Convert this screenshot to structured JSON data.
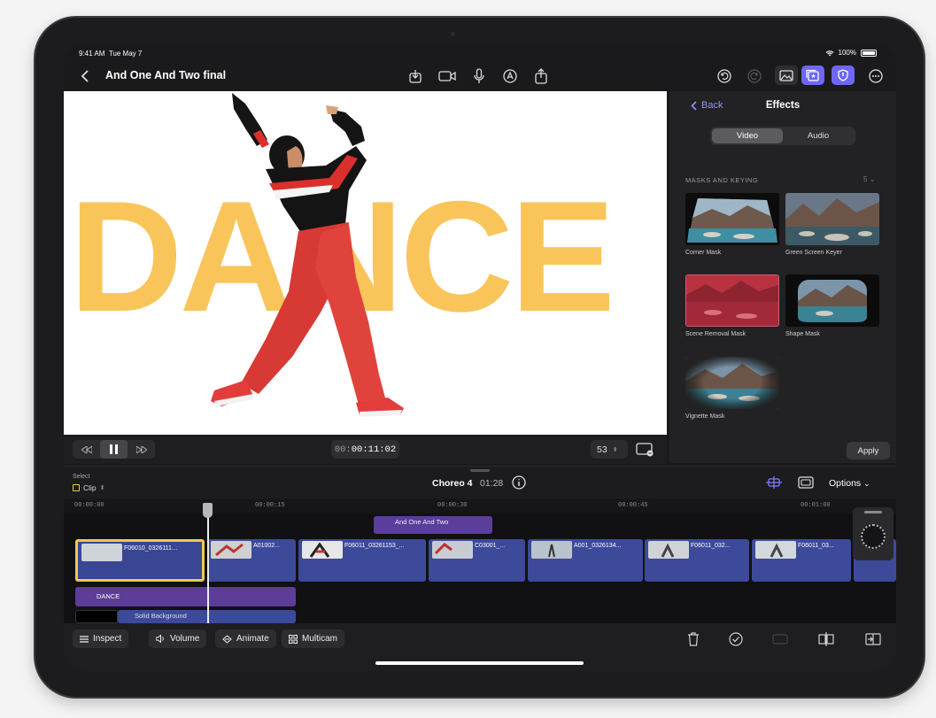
{
  "status": {
    "time": "9:41 AM",
    "date": "Tue May 7",
    "battery": "100%"
  },
  "toolbar": {
    "title": "And One And Two final"
  },
  "viewer": {
    "overlay_text": "DANCE"
  },
  "transport": {
    "timecode_dim": "00:",
    "timecode_main": "00:11:02",
    "zoom": "53"
  },
  "effects": {
    "back_label": "Back",
    "title": "Effects",
    "tabs": [
      {
        "label": "Video",
        "active": true
      },
      {
        "label": "Audio",
        "active": false
      }
    ],
    "section": "MASKS AND KEYING",
    "section_count": "5",
    "items": [
      {
        "label": "Corner Mask"
      },
      {
        "label": "Green Screen Keyer"
      },
      {
        "label": "Scene Removal Mask"
      },
      {
        "label": "Shape Mask"
      },
      {
        "label": "Vignette Mask"
      }
    ],
    "apply_label": "Apply"
  },
  "timeline_header": {
    "select_label": "Select",
    "clip_label": "Clip",
    "project_name": "Choreo 4",
    "duration": "01:28",
    "options_label": "Options"
  },
  "ruler": [
    "00:00:00",
    "00:00:15",
    "00:00:30",
    "00:00:45",
    "00:01:00"
  ],
  "timeline": {
    "connected_clip": "And One And Two",
    "clips": [
      "F06010_0326111…",
      "A01002...",
      "F06011_03261153_...",
      "C03001_...",
      "A001_0326134...",
      "F06011_032...",
      "F06011_03..."
    ],
    "title_clip": "DANCE",
    "background_clip": "Solid Background"
  },
  "bottombar": {
    "inspect": "Inspect",
    "volume": "Volume",
    "animate": "Animate",
    "multicam": "Multicam"
  },
  "colors": {
    "accent": "#7f7cff",
    "title_yellow": "#f9c55a",
    "clip_blue": "#3d4a9a",
    "clip_purple": "#5d3c9a",
    "selection": "#f3c948"
  }
}
